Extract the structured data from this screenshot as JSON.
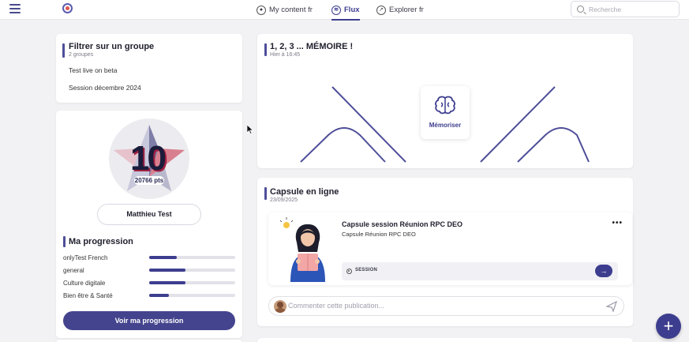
{
  "header": {
    "nav": [
      {
        "label": "My content fr",
        "icon": "user-circle-icon"
      },
      {
        "label": "Flux",
        "icon": "flux-icon",
        "active": true
      },
      {
        "label": "Explorer fr",
        "icon": "compass-icon"
      }
    ],
    "search_placeholder": "Recherche"
  },
  "filter": {
    "title": "Filtrer sur un groupe",
    "count": "2 groupes",
    "groups": [
      "Test live on beta",
      "Session décembre 2024"
    ]
  },
  "profile": {
    "level": "10",
    "points": "20766 pts",
    "name": "Matthieu Test",
    "progress_title": "Ma progression",
    "progress": [
      {
        "label": "onlyTest French",
        "value": 0.32
      },
      {
        "label": "general",
        "value": 0.42
      },
      {
        "label": "Culture digitale",
        "value": 0.42
      },
      {
        "label": "Bien être & Santé",
        "value": 0.23
      }
    ],
    "button": "Voir ma progression"
  },
  "memoire_post": {
    "title": "1, 2, 3 ... MÉMOIRE !",
    "time": "Hier à 16:45",
    "action_label": "Mémoriser",
    "action_icon": "brain-icon"
  },
  "capsule_post": {
    "title": "Capsule en ligne",
    "date": "23/09/2025",
    "capsule_title": "Capsule session Réunion RPC DEO",
    "capsule_subtitle": "Capsule Réunion RPC DEO",
    "more": "•••",
    "session_label": "SESSION",
    "comment_placeholder": "Commenter cette publication..."
  },
  "colors": {
    "accent": "#3d3d8f",
    "background": "#f2f2f4"
  }
}
